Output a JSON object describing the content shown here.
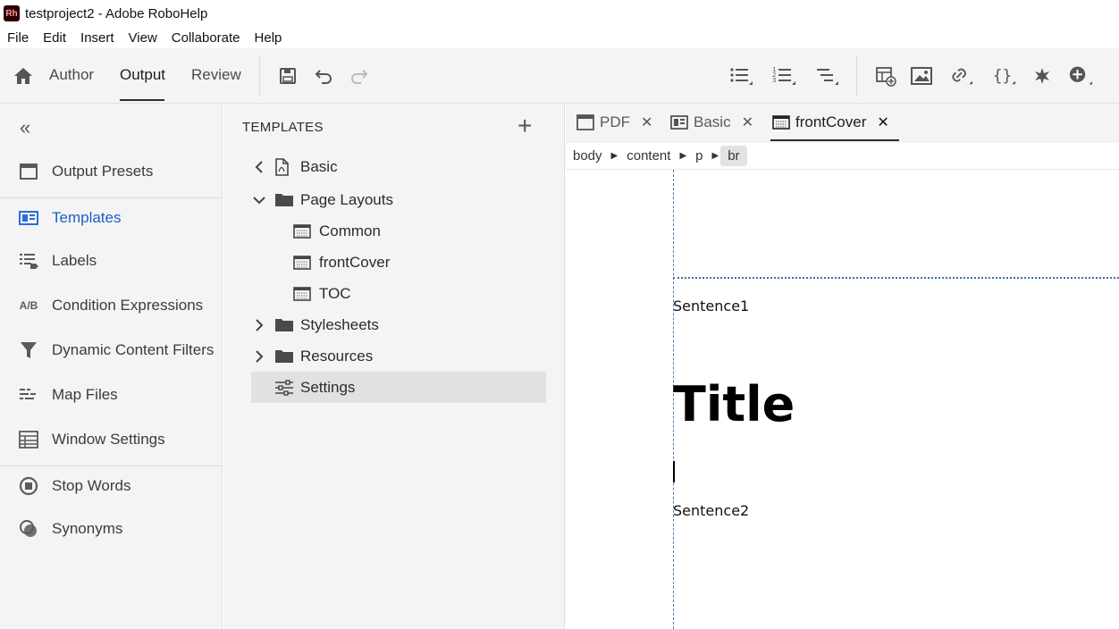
{
  "app": {
    "logo_text": "Rh",
    "window_title": "testproject2 - Adobe RoboHelp"
  },
  "menubar": [
    "File",
    "Edit",
    "Insert",
    "View",
    "Collaborate",
    "Help"
  ],
  "toolbar": {
    "tabs": [
      "Author",
      "Output",
      "Review"
    ],
    "active_tab": "Output"
  },
  "nav": {
    "items": [
      {
        "label": "Output Presets",
        "icon": "output-presets-icon"
      },
      {
        "label": "Templates",
        "icon": "templates-icon",
        "active": true
      },
      {
        "label": "Labels",
        "icon": "labels-icon"
      },
      {
        "label": "Condition Expressions",
        "icon": "ab-icon",
        "icon_text": "A/B"
      },
      {
        "label": "Dynamic Content Filters",
        "icon": "filter-icon"
      },
      {
        "label": "Map Files",
        "icon": "map-files-icon"
      },
      {
        "label": "Window Settings",
        "icon": "window-settings-icon"
      },
      {
        "label": "Stop Words",
        "icon": "stop-words-icon"
      },
      {
        "label": "Synonyms",
        "icon": "synonyms-icon"
      }
    ]
  },
  "templates_panel": {
    "heading": "TEMPLATES",
    "root": "Basic",
    "rows": [
      {
        "label": "Page Layouts"
      },
      {
        "label": "Common"
      },
      {
        "label": "frontCover"
      },
      {
        "label": "TOC"
      },
      {
        "label": "Stylesheets"
      },
      {
        "label": "Resources"
      },
      {
        "label": "Settings"
      }
    ]
  },
  "editor": {
    "tabs": [
      {
        "label": "PDF"
      },
      {
        "label": "Basic"
      },
      {
        "label": "frontCover",
        "active": true
      }
    ],
    "breadcrumb": [
      "body",
      "content",
      "p",
      "br"
    ],
    "content": {
      "sentence1": "Sentence1",
      "title": "Title",
      "sentence2": "Sentence2"
    }
  },
  "colors": {
    "accent": "#1d5fc4",
    "guide": "#4e7fb0"
  }
}
